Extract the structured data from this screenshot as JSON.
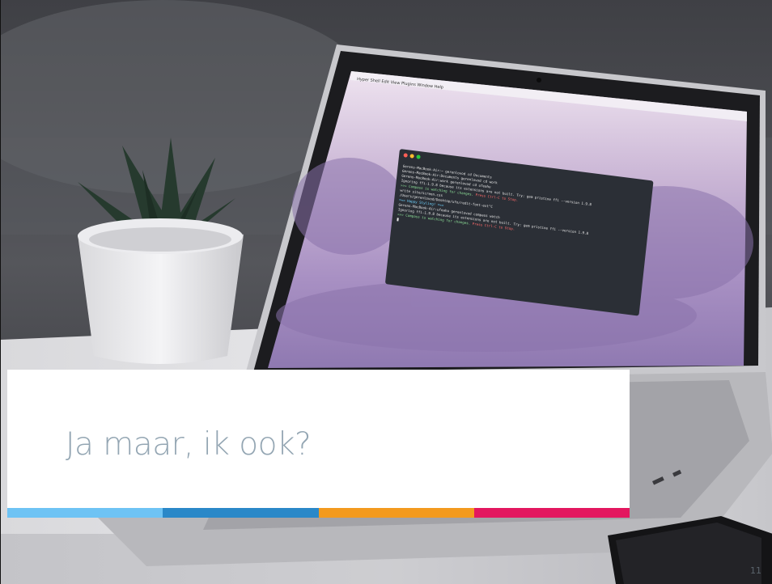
{
  "slide": {
    "title": "Ja maar, ik ook?",
    "page_number": "11"
  },
  "image": {
    "description_icon": "laptop-photo",
    "menubar_items": [
      "Hyper",
      "Shell",
      "Edit",
      "View",
      "Plugins",
      "Window",
      "Help"
    ],
    "terminal_lines": [
      "Gerens-MacBook-Air:~ gerenlovod cd Documents",
      "Gerens-MacBook-Air:Documents gerenlovod cd work",
      "Gerens-MacBook-Air:work gerenlovod cd ufeahu",
      "Ignoring ffi-1.9.8 because its extensions are not built.  Try: gem pristine ffi --version 1.9.8",
      ">>> Compass is watching for changes. Press Ctrl-C to Stop.",
      "    write site/screen.css",
      "/Users/gerenlovod/Desktop/ufo/redit-font-ext^C",
      "===  Happy Styling!  ===",
      "Gerens-MacBook-Air:ufeahu gerenlovod compass watch",
      "Ignoring ffi-1.9.8 because its extensions are not built.  Try: gem pristine ffi --version 1.9.8",
      ">>> Compass is watching for changes. Press Ctrl-C to Stop."
    ]
  },
  "colors": {
    "title": "#94a6b3",
    "stripes": [
      "#6ec3f4",
      "#2a88c8",
      "#f39a1e",
      "#e3175f"
    ]
  }
}
